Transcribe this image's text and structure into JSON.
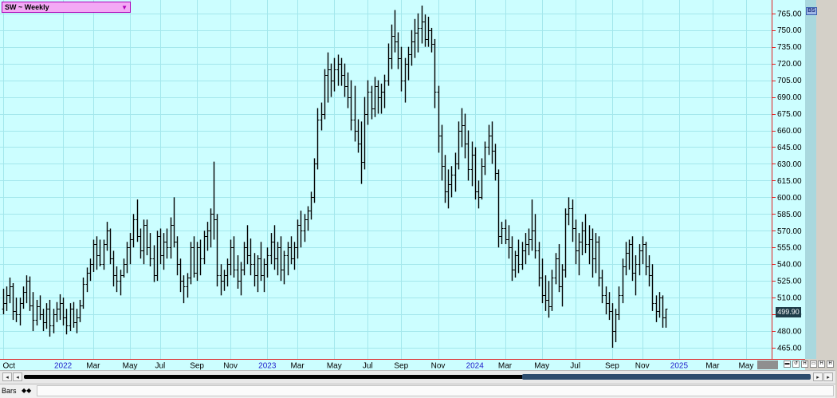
{
  "window": {
    "symbol_title": "SW ~ Weekly",
    "bs_badge": "BS",
    "last_price": "499.90",
    "status_tab": "Bars",
    "status_indicator": "◆◆"
  },
  "scroll": {
    "left_arrow": "◂",
    "right_arrow": "▸",
    "tool_labels": [
      "▬",
      "↺",
      "H",
      "▭",
      "H",
      "H",
      "◂",
      "▸"
    ]
  },
  "colors": {
    "background": "#ccfeff",
    "grid": "#a3e7ec",
    "bars": "#000000",
    "axis_line": "#e02020",
    "year_label": "#2222cc"
  },
  "chart_data": {
    "type": "ohlc-bar",
    "title": "SW ~ Weekly",
    "xlabel": "",
    "ylabel": "",
    "ylim": [
      455,
      777
    ],
    "grid": true,
    "y_ticks": [
      "465.00",
      "480.00",
      "495.00",
      "510.00",
      "525.00",
      "540.00",
      "555.00",
      "570.00",
      "585.00",
      "600.00",
      "615.00",
      "630.00",
      "645.00",
      "660.00",
      "675.00",
      "690.00",
      "705.00",
      "720.00",
      "735.00",
      "750.00",
      "765.00"
    ],
    "x_ticks": [
      {
        "label": "Oct",
        "week": 0,
        "year": false
      },
      {
        "label": "2022",
        "week": 18,
        "year": true
      },
      {
        "label": "Mar",
        "week": 27,
        "year": false
      },
      {
        "label": "May",
        "week": 38,
        "year": false
      },
      {
        "label": "Jul",
        "week": 47,
        "year": false
      },
      {
        "label": "Sep",
        "week": 58,
        "year": false
      },
      {
        "label": "Nov",
        "week": 68,
        "year": false
      },
      {
        "label": "2023",
        "week": 79,
        "year": true
      },
      {
        "label": "Mar",
        "week": 88,
        "year": false
      },
      {
        "label": "May",
        "week": 99,
        "year": false
      },
      {
        "label": "Jul",
        "week": 109,
        "year": false
      },
      {
        "label": "Sep",
        "week": 119,
        "year": false
      },
      {
        "label": "Nov",
        "week": 130,
        "year": false
      },
      {
        "label": "2024",
        "week": 141,
        "year": true
      },
      {
        "label": "Mar",
        "week": 150,
        "year": false
      },
      {
        "label": "May",
        "week": 161,
        "year": false
      },
      {
        "label": "Jul",
        "week": 171,
        "year": false
      },
      {
        "label": "Sep",
        "week": 182,
        "year": false
      },
      {
        "label": "Nov",
        "week": 191,
        "year": false
      },
      {
        "label": "2025",
        "week": 202,
        "year": true
      },
      {
        "label": "Mar",
        "week": 212,
        "year": false
      },
      {
        "label": "May",
        "week": 222,
        "year": false
      }
    ],
    "bars": [
      [
        500,
        518,
        495,
        505
      ],
      [
        505,
        520,
        498,
        512
      ],
      [
        512,
        528,
        505,
        520
      ],
      [
        520,
        523,
        490,
        498
      ],
      [
        498,
        510,
        488,
        495
      ],
      [
        495,
        510,
        485,
        505
      ],
      [
        505,
        520,
        500,
        515
      ],
      [
        515,
        530,
        505,
        525
      ],
      [
        525,
        529,
        498,
        503
      ],
      [
        503,
        515,
        480,
        490
      ],
      [
        490,
        508,
        485,
        502
      ],
      [
        502,
        512,
        490,
        495
      ],
      [
        495,
        500,
        480,
        488
      ],
      [
        488,
        505,
        482,
        500
      ],
      [
        500,
        508,
        475,
        485
      ],
      [
        485,
        500,
        478,
        495
      ],
      [
        495,
        506,
        488,
        500
      ],
      [
        500,
        513,
        490,
        505
      ],
      [
        505,
        510,
        485,
        492
      ],
      [
        492,
        500,
        477,
        485
      ],
      [
        485,
        505,
        480,
        500
      ],
      [
        500,
        506,
        483,
        488
      ],
      [
        488,
        500,
        478,
        492
      ],
      [
        492,
        508,
        488,
        503
      ],
      [
        503,
        528,
        500,
        522
      ],
      [
        522,
        537,
        515,
        532
      ],
      [
        532,
        545,
        525,
        540
      ],
      [
        540,
        562,
        533,
        558
      ],
      [
        558,
        565,
        535,
        548
      ],
      [
        548,
        562,
        538,
        540
      ],
      [
        540,
        562,
        535,
        558
      ],
      [
        558,
        578,
        552,
        570
      ],
      [
        570,
        572,
        540,
        545
      ],
      [
        545,
        552,
        520,
        530
      ],
      [
        530,
        538,
        515,
        525
      ],
      [
        525,
        535,
        512,
        530
      ],
      [
        530,
        545,
        528,
        540
      ],
      [
        540,
        560,
        532,
        555
      ],
      [
        555,
        568,
        540,
        562
      ],
      [
        562,
        585,
        555,
        580
      ],
      [
        580,
        598,
        560,
        565
      ],
      [
        565,
        572,
        545,
        552
      ],
      [
        552,
        580,
        540,
        575
      ],
      [
        575,
        580,
        548,
        555
      ],
      [
        555,
        568,
        538,
        545
      ],
      [
        545,
        557,
        524,
        530
      ],
      [
        530,
        570,
        525,
        565
      ],
      [
        565,
        572,
        540,
        548
      ],
      [
        548,
        568,
        535,
        560
      ],
      [
        560,
        572,
        545,
        555
      ],
      [
        555,
        582,
        545,
        575
      ],
      [
        575,
        600,
        555,
        560
      ],
      [
        560,
        565,
        530,
        540
      ],
      [
        540,
        545,
        515,
        525
      ],
      [
        525,
        530,
        505,
        520
      ],
      [
        520,
        532,
        510,
        528
      ],
      [
        528,
        560,
        522,
        555
      ],
      [
        555,
        565,
        528,
        532
      ],
      [
        532,
        560,
        525,
        555
      ],
      [
        555,
        562,
        530,
        545
      ],
      [
        545,
        570,
        540,
        565
      ],
      [
        565,
        578,
        552,
        570
      ],
      [
        570,
        590,
        555,
        585
      ],
      [
        585,
        632,
        562,
        580
      ],
      [
        580,
        585,
        520,
        530
      ],
      [
        530,
        540,
        512,
        525
      ],
      [
        525,
        535,
        516,
        530
      ],
      [
        530,
        545,
        520,
        540
      ],
      [
        540,
        562,
        530,
        555
      ],
      [
        555,
        565,
        528,
        535
      ],
      [
        535,
        548,
        518,
        525
      ],
      [
        525,
        542,
        512,
        535
      ],
      [
        535,
        560,
        530,
        555
      ],
      [
        555,
        575,
        540,
        548
      ],
      [
        548,
        563,
        530,
        540
      ],
      [
        540,
        550,
        520,
        530
      ],
      [
        530,
        548,
        515,
        545
      ],
      [
        545,
        560,
        525,
        530
      ],
      [
        530,
        545,
        515,
        540
      ],
      [
        540,
        555,
        528,
        548
      ],
      [
        548,
        568,
        540,
        560
      ],
      [
        560,
        575,
        535,
        545
      ],
      [
        545,
        560,
        530,
        555
      ],
      [
        555,
        565,
        525,
        535
      ],
      [
        535,
        552,
        522,
        548
      ],
      [
        548,
        560,
        530,
        555
      ],
      [
        555,
        565,
        540,
        545
      ],
      [
        545,
        560,
        535,
        555
      ],
      [
        555,
        580,
        545,
        575
      ],
      [
        575,
        588,
        555,
        570
      ],
      [
        570,
        585,
        560,
        580
      ],
      [
        580,
        592,
        570,
        588
      ],
      [
        588,
        605,
        580,
        600
      ],
      [
        600,
        635,
        595,
        630
      ],
      [
        630,
        680,
        625,
        670
      ],
      [
        670,
        685,
        660,
        675
      ],
      [
        675,
        715,
        670,
        710
      ],
      [
        710,
        730,
        685,
        715
      ],
      [
        715,
        720,
        690,
        705
      ],
      [
        705,
        725,
        695,
        715
      ],
      [
        715,
        728,
        700,
        720
      ],
      [
        720,
        725,
        700,
        710
      ],
      [
        710,
        720,
        690,
        700
      ],
      [
        700,
        712,
        680,
        690
      ],
      [
        690,
        705,
        660,
        670
      ],
      [
        670,
        700,
        650,
        660
      ],
      [
        660,
        670,
        640,
        648
      ],
      [
        648,
        668,
        612,
        632
      ],
      [
        632,
        690,
        625,
        675
      ],
      [
        675,
        705,
        665,
        695
      ],
      [
        695,
        700,
        670,
        680
      ],
      [
        680,
        708,
        672,
        700
      ],
      [
        700,
        705,
        675,
        690
      ],
      [
        690,
        702,
        675,
        695
      ],
      [
        695,
        710,
        680,
        705
      ],
      [
        705,
        738,
        700,
        725
      ],
      [
        725,
        755,
        715,
        745
      ],
      [
        745,
        768,
        730,
        740
      ],
      [
        740,
        748,
        715,
        725
      ],
      [
        725,
        735,
        695,
        705
      ],
      [
        705,
        725,
        685,
        720
      ],
      [
        720,
        735,
        705,
        728
      ],
      [
        728,
        750,
        718,
        740
      ],
      [
        740,
        760,
        725,
        748
      ],
      [
        748,
        765,
        730,
        752
      ],
      [
        752,
        772,
        738,
        758
      ],
      [
        758,
        764,
        735,
        742
      ],
      [
        742,
        762,
        735,
        750
      ],
      [
        750,
        752,
        730,
        738
      ],
      [
        738,
        742,
        680,
        695
      ],
      [
        695,
        700,
        640,
        655
      ],
      [
        655,
        665,
        615,
        628
      ],
      [
        628,
        638,
        595,
        605
      ],
      [
        605,
        625,
        590,
        612
      ],
      [
        612,
        628,
        600,
        620
      ],
      [
        620,
        640,
        605,
        630
      ],
      [
        630,
        668,
        625,
        660
      ],
      [
        660,
        680,
        645,
        665
      ],
      [
        665,
        675,
        635,
        648
      ],
      [
        648,
        660,
        615,
        625
      ],
      [
        625,
        650,
        610,
        638
      ],
      [
        638,
        645,
        598,
        605
      ],
      [
        605,
        615,
        590,
        600
      ],
      [
        600,
        635,
        598,
        628
      ],
      [
        628,
        650,
        620,
        645
      ],
      [
        645,
        665,
        638,
        655
      ],
      [
        655,
        668,
        630,
        642
      ],
      [
        642,
        648,
        615,
        622
      ],
      [
        622,
        625,
        555,
        565
      ],
      [
        565,
        578,
        558,
        572
      ],
      [
        572,
        580,
        558,
        562
      ],
      [
        562,
        575,
        545,
        555
      ],
      [
        555,
        565,
        525,
        535
      ],
      [
        535,
        552,
        528,
        548
      ],
      [
        548,
        562,
        532,
        540
      ],
      [
        540,
        560,
        535,
        552
      ],
      [
        552,
        568,
        540,
        558
      ],
      [
        558,
        572,
        548,
        562
      ],
      [
        562,
        598,
        552,
        570
      ],
      [
        570,
        585,
        545,
        552
      ],
      [
        552,
        560,
        520,
        528
      ],
      [
        528,
        545,
        505,
        512
      ],
      [
        512,
        530,
        498,
        508
      ],
      [
        508,
        525,
        492,
        502
      ],
      [
        502,
        535,
        498,
        528
      ],
      [
        528,
        550,
        522,
        545
      ],
      [
        545,
        558,
        515,
        520
      ],
      [
        520,
        540,
        502,
        535
      ],
      [
        535,
        590,
        528,
        585
      ],
      [
        585,
        600,
        575,
        590
      ],
      [
        590,
        598,
        560,
        572
      ],
      [
        572,
        580,
        540,
        552
      ],
      [
        552,
        568,
        530,
        560
      ],
      [
        560,
        578,
        548,
        570
      ],
      [
        570,
        585,
        550,
        558
      ],
      [
        558,
        575,
        540,
        562
      ],
      [
        562,
        572,
        528,
        545
      ],
      [
        545,
        568,
        532,
        560
      ],
      [
        560,
        565,
        520,
        528
      ],
      [
        528,
        535,
        505,
        512
      ],
      [
        512,
        520,
        495,
        505
      ],
      [
        505,
        515,
        490,
        498
      ],
      [
        498,
        505,
        465,
        480
      ],
      [
        480,
        500,
        470,
        495
      ],
      [
        495,
        520,
        490,
        512
      ],
      [
        512,
        545,
        505,
        538
      ],
      [
        538,
        560,
        530,
        550
      ],
      [
        550,
        562,
        535,
        558
      ],
      [
        558,
        565,
        525,
        532
      ],
      [
        532,
        548,
        512,
        540
      ],
      [
        540,
        558,
        530,
        552
      ],
      [
        552,
        565,
        540,
        558
      ],
      [
        558,
        560,
        530,
        538
      ],
      [
        538,
        548,
        520,
        530
      ],
      [
        530,
        540,
        498,
        505
      ],
      [
        505,
        512,
        488,
        498
      ],
      [
        498,
        515,
        492,
        510
      ],
      [
        510,
        512,
        483,
        492
      ],
      [
        492,
        500,
        483,
        499.9
      ]
    ]
  }
}
